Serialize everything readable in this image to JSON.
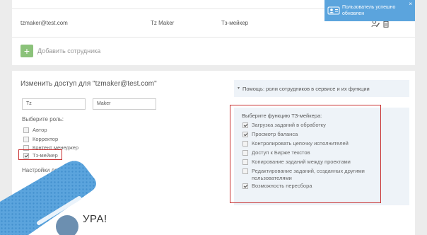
{
  "users_table": {
    "row": {
      "email": "tzmaker@test.com",
      "name": "Tz Maker",
      "role": "Тз-мейкер"
    },
    "add_employee_label": "Добавить сотрудника",
    "add_icon": "+"
  },
  "toast": {
    "message": "Пользователь успешно обновлен",
    "close": "×",
    "color": "#5ba4dd"
  },
  "edit_access": {
    "title": "Изменить доступ для \"tzmaker@test.com\"",
    "first_name": "Tz",
    "last_name": "Maker",
    "choose_role_label": "Выберите роль:",
    "roles": [
      {
        "label": "Автор",
        "checked": false
      },
      {
        "label": "Корректор",
        "checked": false
      },
      {
        "label": "Контент менеджер",
        "checked": false
      },
      {
        "label": "Тз-мейкер",
        "checked": true
      }
    ],
    "access_settings_label": "Настройки доступа:",
    "help_icon": "?"
  },
  "help_panel": {
    "caret": "▾",
    "text": "Помощь: роли сотрудников в сервисе и их функции"
  },
  "functions": {
    "title": "Выберите функцию ТЗ-мейкера:",
    "items": [
      {
        "label": "Загрузка заданий в обработку",
        "checked": true
      },
      {
        "label": "Просмотр баланса",
        "checked": true
      },
      {
        "label": "Контролировать цепочку исполнителей",
        "checked": false
      },
      {
        "label": "Доступ к Бирже текстов",
        "checked": false
      },
      {
        "label": "Копирование заданий между проектами",
        "checked": false
      },
      {
        "label": "Редактирование заданий, созданных другими пользователями",
        "checked": false
      },
      {
        "label": "Возможность пересбора",
        "checked": true
      }
    ]
  },
  "overlay_caption": "УРА!",
  "colors": {
    "highlight": "#c83232",
    "add_button": "#8bc27a",
    "decor_blue": "#5ba4dd"
  }
}
